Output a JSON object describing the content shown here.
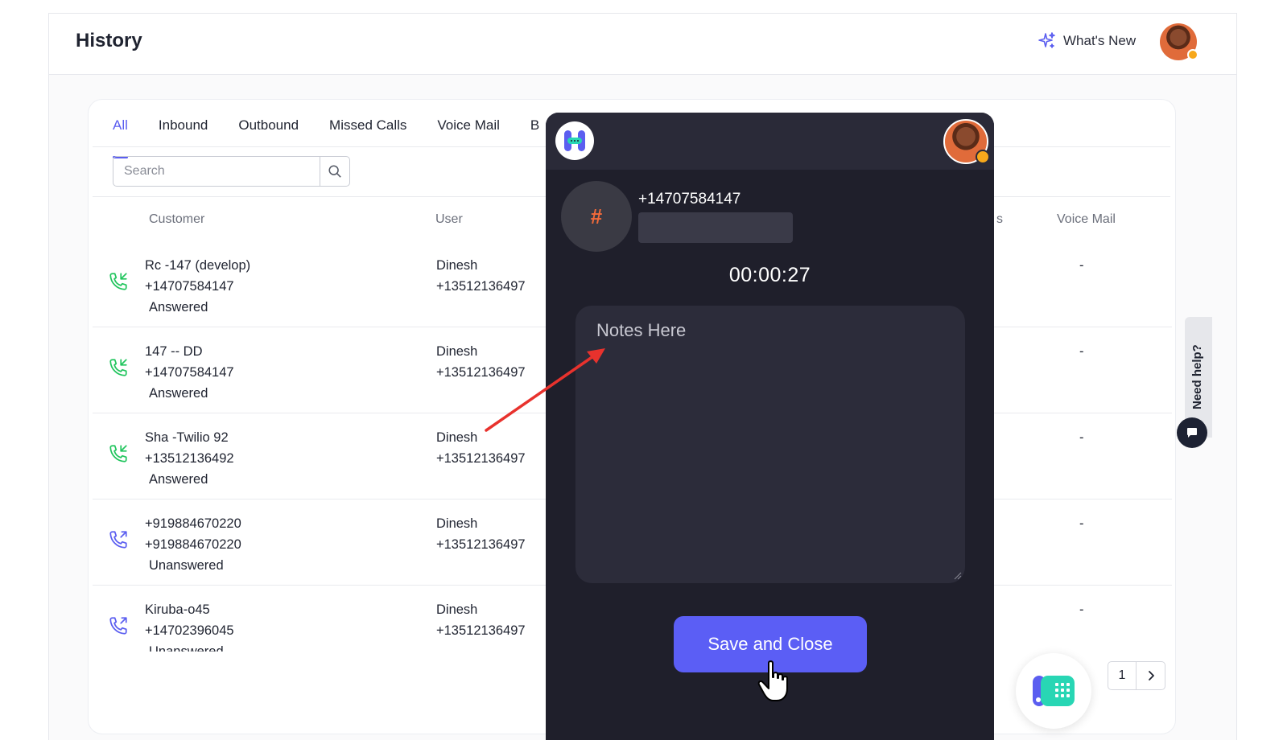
{
  "header": {
    "title": "History",
    "whats_new": "What's New"
  },
  "tabs": [
    {
      "label": "All",
      "active": true
    },
    {
      "label": "Inbound"
    },
    {
      "label": "Outbound"
    },
    {
      "label": "Missed Calls"
    },
    {
      "label": "Voice Mail"
    },
    {
      "label": "B"
    }
  ],
  "search": {
    "placeholder": "Search",
    "value": ""
  },
  "columns": {
    "customer": "Customer",
    "user": "User",
    "partial": "s",
    "voice_mail": "Voice Mail"
  },
  "rows": [
    {
      "direction": "inbound",
      "customer_name": "Rc -147 (develop)",
      "customer_number": "+14707584147",
      "status": "Answered",
      "user_name": "Dinesh",
      "user_number": "+13512136497",
      "voice_mail": "-"
    },
    {
      "direction": "inbound",
      "customer_name": "147 -- DD",
      "customer_number": "+14707584147",
      "status": "Answered",
      "user_name": "Dinesh",
      "user_number": "+13512136497",
      "voice_mail": "-"
    },
    {
      "direction": "inbound",
      "customer_name": "Sha -Twilio 92",
      "customer_number": "+13512136492",
      "status": "Answered",
      "user_name": "Dinesh",
      "user_number": "+13512136497",
      "voice_mail": "-"
    },
    {
      "direction": "outbound",
      "customer_name": "+919884670220",
      "customer_number": "+919884670220",
      "status": "Unanswered",
      "user_name": "Dinesh",
      "user_number": "+13512136497",
      "voice_mail": "-"
    },
    {
      "direction": "outbound",
      "customer_name": "Kiruba-o45",
      "customer_number": "+14702396045",
      "status": "Unanswered",
      "user_name": "Dinesh",
      "user_number": "+13512136497",
      "voice_mail": "-"
    }
  ],
  "pagination": {
    "page": "1"
  },
  "help": {
    "label": "Need help?"
  },
  "dialer": {
    "hash_symbol": "#",
    "phone_number": "+14707584147",
    "timer": "00:00:27",
    "notes_placeholder": "Notes Here",
    "notes_value": "",
    "save_button": "Save and Close"
  },
  "colors": {
    "accent": "#5b5ef0",
    "inbound_icon": "#22c55e",
    "outbound_icon": "#5b5ef0",
    "dialer_bg": "#1f1f2b",
    "annotation_arrow": "#e8322d",
    "status_dot": "#f7a81b"
  },
  "icons": {
    "whats_new": "sparkle-icon",
    "search": "search-icon",
    "inbound": "phone-incoming-icon",
    "outbound": "phone-outgoing-icon",
    "next": "chevron-right-icon",
    "chat": "chat-bubble-icon",
    "dialpad": "dialpad-icon",
    "cursor": "hand-pointer-icon"
  }
}
